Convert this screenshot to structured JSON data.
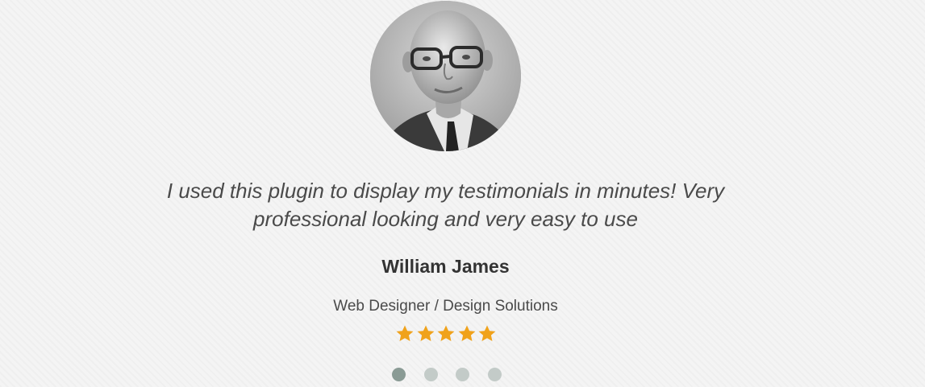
{
  "testimonial": {
    "quote": "I used this plugin to display my testimonials in minutes! Very professional looking and very easy to use",
    "author_name": "William James",
    "author_role": "Web Designer / Design Solutions",
    "rating": 5,
    "rating_max": 5,
    "star_icon": "star-icon",
    "star_color": "#f0a21b"
  },
  "carousel": {
    "slide_count": 4,
    "active_index": 0,
    "dot_active_color": "#8a9b95",
    "dot_inactive_color": "#c3cbc8"
  },
  "colors": {
    "background": "#f4f4f4",
    "text": "#4a4a4a",
    "name": "#333333"
  }
}
